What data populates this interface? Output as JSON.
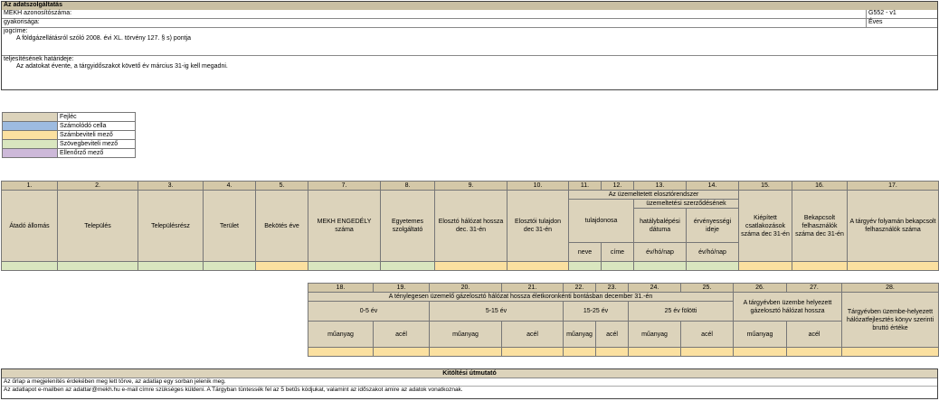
{
  "service": {
    "title": "Az adatszolgáltatás",
    "code_label": "MEKH azonosítószáma:",
    "code_value": "G552 - v1",
    "freq_label": "gyakorisága:",
    "freq_value": "Éves",
    "legal_label": "jogcíme:",
    "legal_value": "A földgázellátásról szóló 2008. évi XL. törvény 127. § s) pontja",
    "deadline_label": "teljesítésének határideje:",
    "deadline_value": "Az adatokat évente, a tárgyidőszakot követő év március 31-ig kell megadni."
  },
  "legend": [
    {
      "label": "Fejléc",
      "color": "#dcd3bb"
    },
    {
      "label": "Számolódó cella",
      "color": "#9dbbe0"
    },
    {
      "label": "Számbeviteli mező",
      "color": "#fbe0a0"
    },
    {
      "label": "Szövegbeviteli mező",
      "color": "#d9e6bf"
    },
    {
      "label": "Ellenőrző mező",
      "color": "#cdb9d9"
    }
  ],
  "table1": {
    "nums": [
      "1.",
      "2.",
      "3.",
      "4.",
      "5.",
      "7.",
      "8.",
      "9.",
      "10.",
      "11.",
      "12.",
      "13.",
      "14.",
      "15.",
      "16.",
      "17."
    ],
    "h_atado": "Átadó állomás",
    "h_telepules": "Település",
    "h_telepulesresz": "Településrész",
    "h_terulet": "Terület",
    "h_bekotes": "Bekötés éve",
    "h_mekh": "MEKH ENGEDÉLY száma",
    "h_egyetemes": "Egyetemes szolgáltató",
    "h_eloszto_hossz": "Elosztó hálózat hossza dec. 31-én",
    "h_eloszto_tul": "Elosztói tulajdon dec 31-én",
    "h_uzemeltetett": "Az üzemeltetett elosztórendszer",
    "h_tulajdonosa": "tulajdonosa",
    "h_szerzodes": "üzemeltetési szerződésének",
    "h_hatalyba": "hatálybalépési dátuma",
    "h_ervenyes": "érvényességi ideje",
    "h_neve": "neve",
    "h_cime": "címe",
    "h_date1": "év/hó/nap",
    "h_date2": "év/hó/nap",
    "h_kiepitett": "Kiépített csatlakozások száma dec 31-én",
    "h_bekapcsolt": "Bekapcsolt felhasználók száma dec 31-én",
    "h_targyev": "A tárgyév folyamán bekapcsolt felhasználók száma"
  },
  "table2": {
    "nums": [
      "18.",
      "19.",
      "20.",
      "21.",
      "22.",
      "23.",
      "24.",
      "25.",
      "26.",
      "27.",
      "28."
    ],
    "h_main": "A ténylegesen üzemelő gázelosztó hálózat hossza életkoronkénti bontásban december 31.-én",
    "h_0_5": "0-5 év",
    "h_5_15": "5-15 év",
    "h_15_25": "15-25 év",
    "h_25": "25 év fölötti",
    "h_uzembe": "A tárgyévben üzembe helyezett gázelosztó hálózat hossza",
    "h_brutto": "Tárgyévben üzembe-helyezett hálózatfejlesztés könyv szerinti bruttó értéke",
    "materials": [
      "műanyag",
      "acél",
      "műanyag",
      "acél",
      "műanyag",
      "acél",
      "műanyag",
      "acél",
      "műanyag",
      "acél"
    ]
  },
  "guide": {
    "title": "Kitöltési útmutató",
    "line1": "Az űrlap a megjelenítés érdekében meg lett törve, az adatlap egy sorban jelenik meg.",
    "line2": "Az adatlapot e-mailben az adattar@mekh.hu e-mail címre szükséges küldeni. A Tárgyban tüntessék fel az 5 betűs kódjukat, valamint az időszakot amire az adatok vonatkoznak."
  }
}
